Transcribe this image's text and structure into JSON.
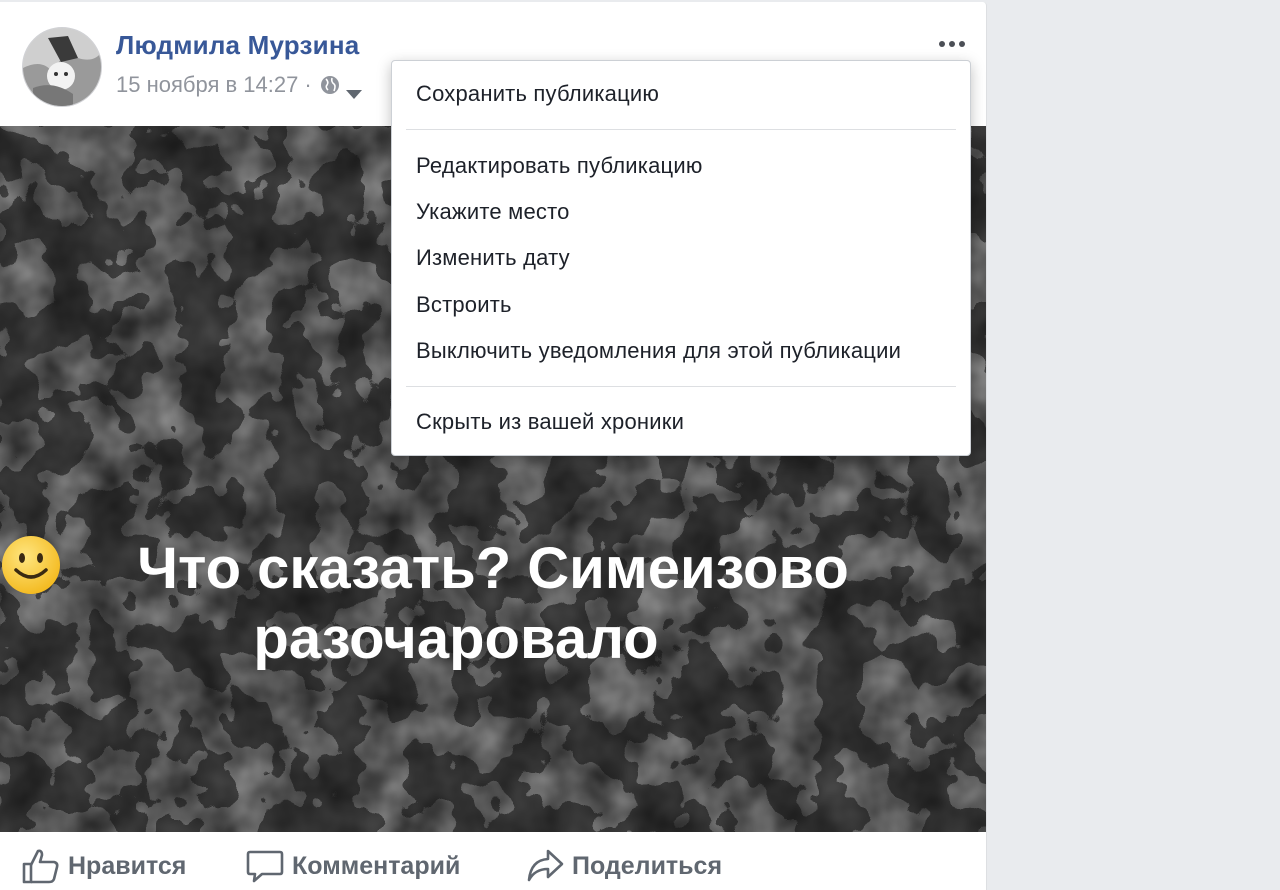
{
  "post": {
    "author": "Людмила Мурзина",
    "timestamp": "15 ноября в 14:27",
    "separator": "·",
    "privacy_icon": "globe-icon",
    "photo_text_line1": "Что сказать? Симеизово",
    "photo_text_line2": "разочаровало"
  },
  "menu": {
    "items": [
      "Сохранить публикацию",
      "Редактировать публикацию",
      "Укажите место",
      "Изменить дату",
      "Встроить",
      "Выключить уведомления для этой публикации",
      "Скрыть из вашей хроники"
    ]
  },
  "actions": {
    "like": "Нравится",
    "comment": "Комментарий",
    "share": "Поделиться"
  },
  "colors": {
    "author": "#385898",
    "meta": "#90949c",
    "action": "#606770",
    "background": "#e9ebee"
  }
}
